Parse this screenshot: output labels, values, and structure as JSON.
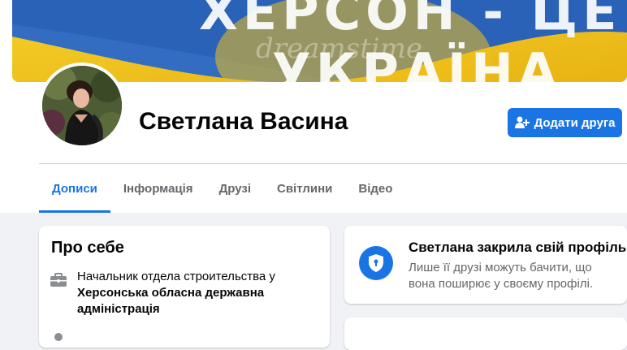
{
  "cover": {
    "line1": "ХЕРСОН - ЦЕ",
    "line2": "УКРАЇНА",
    "watermark": "dreamstime",
    "colors": {
      "blue": "#2a62b8",
      "yellow": "#f2c21c"
    }
  },
  "profile": {
    "name": "Светлана Васина",
    "add_friend_label": "Додати друга",
    "add_friend_icon": "person-add-icon"
  },
  "tabs": [
    {
      "label": "Дописи",
      "active": true
    },
    {
      "label": "Інформація",
      "active": false
    },
    {
      "label": "Друзі",
      "active": false
    },
    {
      "label": "Світлини",
      "active": false
    },
    {
      "label": "Відео",
      "active": false
    }
  ],
  "about": {
    "title": "Про себе",
    "job_prefix": "Начальник отдела строительства у",
    "job_org": "Херсонська обласна державна адміністрація",
    "job_icon": "briefcase-icon"
  },
  "locked_profile": {
    "title": "Светлана закрила свій профіль",
    "description": "Лише її друзі можуть бачити, що вона поширює у своєму профілі.",
    "icon": "shield-icon"
  },
  "colors": {
    "accent": "#1b74e4",
    "background": "#f0f2f5",
    "secondary_text": "#65676b"
  }
}
